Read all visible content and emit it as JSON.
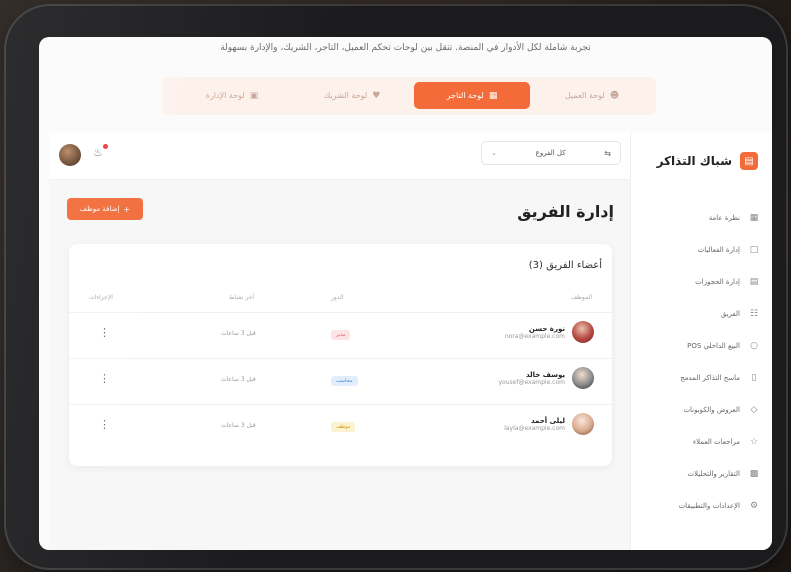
{
  "tagline": "تجربة شاملة لكل الأدوار في المنصة. تنقل بين لوحات تحكم العميل، التاجر، الشريك، والإدارة بسهولة",
  "modes": [
    {
      "label": "لوحة العميل",
      "icon": "user-icon",
      "active": false
    },
    {
      "label": "لوحة التاجر",
      "icon": "store-icon",
      "active": true
    },
    {
      "label": "لوحة الشريك",
      "icon": "handshake-icon",
      "active": false
    },
    {
      "label": "لوحة الإدارة",
      "icon": "dashboard-icon",
      "active": false
    }
  ],
  "sidebar": {
    "brand": "شباك التذاكر",
    "items": [
      {
        "label": "نظرة عامة",
        "icon": "grid-icon"
      },
      {
        "label": "إدارة الفعاليات",
        "icon": "folder-icon"
      },
      {
        "label": "إدارة الحجوزات",
        "icon": "clipboard-icon"
      },
      {
        "label": "الفريق",
        "icon": "team-icon"
      },
      {
        "label": "البيع الداخلي POS",
        "icon": "cart-icon"
      },
      {
        "label": "ماسح التذاكر المدمج",
        "icon": "phone-scan-icon"
      },
      {
        "label": "العروض والكوبونات",
        "icon": "tag-icon"
      },
      {
        "label": "مراجعات العملاء",
        "icon": "star-icon"
      },
      {
        "label": "التقارير والتحليلات",
        "icon": "chart-icon"
      },
      {
        "label": "الإعدادات والتطبيقات",
        "icon": "settings-icon"
      }
    ]
  },
  "topbar": {
    "store_select": "كل الفروع",
    "notification_dot_color": "#ef3a3a"
  },
  "page": {
    "title": "إدارة الفريق",
    "add_button": "إضافة موظف"
  },
  "team": {
    "title": "أعضاء الفريق (3)",
    "columns": [
      "الموظف",
      "الدور",
      "آخر نشاط",
      "الإجراءات"
    ],
    "rows": [
      {
        "name": "نورة حسن",
        "email": "nora@example.com",
        "role": "مدير",
        "role_bg": "#fde3e3",
        "role_color": "#e25a5a",
        "last": "قبل 3 ساعات"
      },
      {
        "name": "يوسف خالد",
        "email": "yousef@example.com",
        "role": "محاسب",
        "role_bg": "#e3eefd",
        "role_color": "#4a7fd6",
        "last": "قبل 3 ساعات"
      },
      {
        "name": "ليلى أحمد",
        "email": "layla@example.com",
        "role": "موظف",
        "role_bg": "#fdf2cf",
        "role_color": "#c99a18",
        "last": "قبل 3 ساعات"
      }
    ]
  },
  "colors": {
    "accent": "#f26b38"
  }
}
